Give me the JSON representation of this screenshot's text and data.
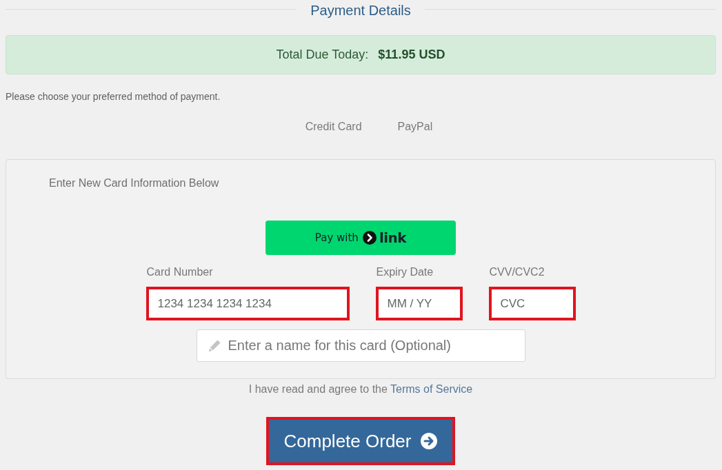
{
  "section_title": "Payment Details",
  "total_due": {
    "label": "Total Due Today:",
    "amount": "$11.95 USD"
  },
  "instruction": "Please choose your preferred method of payment.",
  "payment_methods": [
    {
      "label": "Credit Card"
    },
    {
      "label": "PayPal"
    }
  ],
  "card_form": {
    "heading": "Enter New Card Information Below",
    "link_button": {
      "label": "Pay with",
      "brand": "link"
    },
    "fields": [
      {
        "label": "Card Number",
        "placeholder": "1234 1234 1234 1234",
        "highlighted": true
      },
      {
        "label": "Expiry Date",
        "placeholder": "MM / YY",
        "highlighted": true
      },
      {
        "label": "CVV/CVC2",
        "placeholder": "CVC",
        "highlighted": true
      }
    ],
    "name_field": {
      "placeholder": "Enter a name for this card (Optional)"
    }
  },
  "terms": {
    "text": "I have read and agree to the",
    "link": "Terms of Service"
  },
  "submit_button": {
    "label": "Complete Order",
    "highlighted": true
  }
}
